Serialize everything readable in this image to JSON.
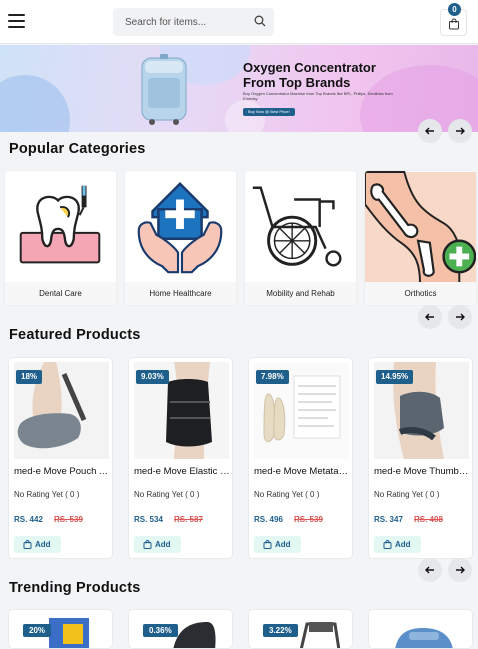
{
  "header": {
    "search_placeholder": "Search for items...",
    "cart_count": "0"
  },
  "banner": {
    "title_line1": "Oxygen Concentrator",
    "title_line2": "From Top Brands",
    "subtitle": "Buy Oxygen Concentrator Machine from Top Brands like BPL, Philips, Devilbiss from Emedsy",
    "cta": "Buy Now @ Best Price!"
  },
  "popular_categories": {
    "title": "Popular Categories",
    "items": [
      {
        "label": "Dental Care",
        "icon": "tooth-icon"
      },
      {
        "label": "Home Healthcare",
        "icon": "home-care-icon"
      },
      {
        "label": "Mobility and Rehab",
        "icon": "wheelchair-icon"
      },
      {
        "label": "Orthotics",
        "icon": "knee-joint-icon"
      }
    ]
  },
  "featured_products": {
    "title": "Featured Products",
    "items": [
      {
        "discount": "18%",
        "name": "med-e Move Pouch Arm Sling",
        "rating": "No Rating Yet",
        "rating_count": "( 0 )",
        "price": "RS. 442",
        "mrp": "RS. 539",
        "add_label": "Add"
      },
      {
        "discount": "9.03%",
        "name": "med-e Move Elastic Wrist Brace",
        "rating": "No Rating Yet",
        "rating_count": "( 0 )",
        "price": "RS. 534",
        "mrp": "RS. 587",
        "add_label": "Add"
      },
      {
        "discount": "7.98%",
        "name": "med-e Move Metatarsal Pad",
        "rating": "No Rating Yet",
        "rating_count": "( 0 )",
        "price": "RS. 496",
        "mrp": "RS. 539",
        "add_label": "Add"
      },
      {
        "discount": "14.95%",
        "name": "med-e Move Thumb Spica Splint",
        "rating": "No Rating Yet",
        "rating_count": "( 0 )",
        "price": "RS. 347",
        "mrp": "RS. 408",
        "add_label": "Add"
      }
    ]
  },
  "trending_products": {
    "title": "Trending Products",
    "items": [
      {
        "discount": "20%"
      },
      {
        "discount": "0.36%"
      },
      {
        "discount": "3.22%"
      },
      {
        "discount": ""
      }
    ]
  },
  "colors": {
    "brand": "#1e5f8c",
    "mrp": "#e05555",
    "add_bg": "#e3f7f3"
  }
}
